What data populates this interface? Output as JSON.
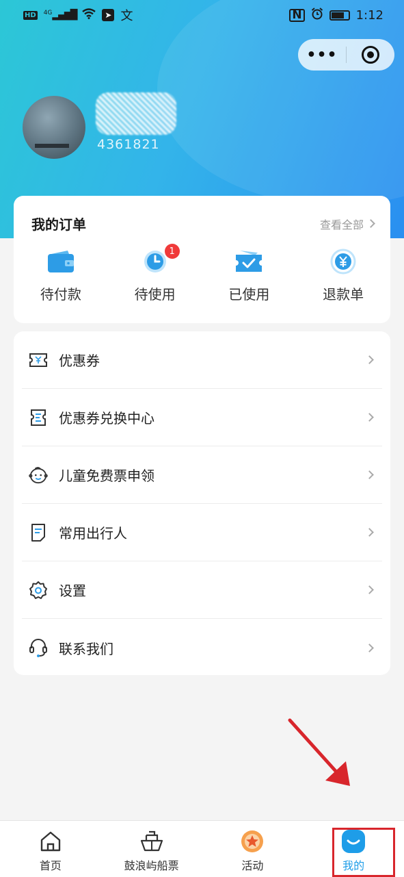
{
  "status_bar": {
    "left_icons": [
      "HD",
      "4G",
      "signal-icon",
      "wifi-icon",
      "app-icon",
      "文"
    ],
    "right_icons": [
      "nfc-icon",
      "alarm-icon",
      "battery-icon"
    ],
    "time": "1:12"
  },
  "capsule": {
    "more_label": "•••"
  },
  "profile": {
    "user_id": "4361821"
  },
  "orders": {
    "title": "我的订单",
    "view_all": "查看全部",
    "items": [
      {
        "label": "待付款",
        "icon": "wallet-icon"
      },
      {
        "label": "待使用",
        "icon": "clock-icon",
        "badge": "1"
      },
      {
        "label": "已使用",
        "icon": "ticket-check-icon"
      },
      {
        "label": "退款单",
        "icon": "refund-icon"
      }
    ]
  },
  "menu": {
    "items": [
      {
        "label": "优惠券",
        "icon": "coupon-icon"
      },
      {
        "label": "优惠券兑换中心",
        "icon": "exchange-icon"
      },
      {
        "label": "儿童免费票申领",
        "icon": "child-face-icon"
      },
      {
        "label": "常用出行人",
        "icon": "traveler-doc-icon"
      },
      {
        "label": "设置",
        "icon": "gear-icon"
      },
      {
        "label": "联系我们",
        "icon": "headset-icon"
      }
    ]
  },
  "tabbar": {
    "items": [
      {
        "label": "首页",
        "icon": "home-icon"
      },
      {
        "label": "鼓浪屿船票",
        "icon": "ship-icon"
      },
      {
        "label": "活动",
        "icon": "activity-star-icon"
      },
      {
        "label": "我的",
        "icon": "profile-smile-icon",
        "active": true
      }
    ]
  },
  "colors": {
    "accent": "#1e9de8",
    "hero_start": "#2cc7d6",
    "hero_end": "#2a8ff0",
    "badge": "#f03a3a",
    "annotation": "#d8262c"
  }
}
